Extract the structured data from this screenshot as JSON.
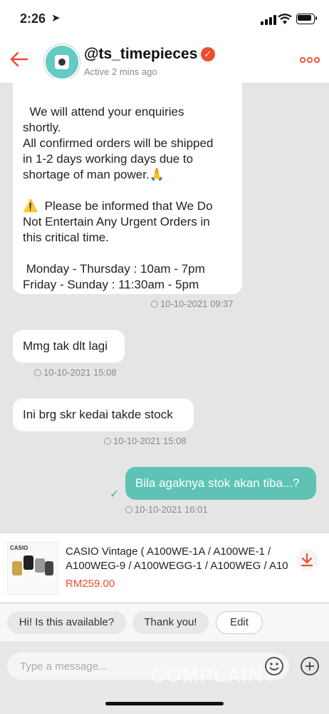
{
  "status_bar": {
    "time": "2:26",
    "location_glyph": "➤"
  },
  "header": {
    "shop_name": "@ts_timepieces",
    "status": "Active 2 mins ago",
    "verified_glyph": "✓",
    "more_glyph": "ooo"
  },
  "messages": [
    {
      "direction": "incoming",
      "lines": [
        "  We will attend your enquiries",
        "shortly.",
        "All confirmed orders will be shipped",
        "in 1-2 days working days due to",
        "shortage of man power.🙏",
        "",
        "⚠️  Please be informed that We Do",
        "Not Entertain Any Urgent Orders in",
        "this critical time.",
        "",
        " Monday - Thursday : 10am - 7pm",
        "Friday - Sunday : 11:30am - 5pm"
      ],
      "timestamp": "10-10-2021 09:37"
    },
    {
      "direction": "incoming",
      "text": "Mmg tak dlt lagi",
      "timestamp": "10-10-2021 15:08"
    },
    {
      "direction": "incoming",
      "text": "Ini brg skr kedai takde stock",
      "timestamp": "10-10-2021 15:08"
    },
    {
      "direction": "outgoing",
      "text": "Bila agaknya stok akan tiba...?",
      "timestamp": "10-10-2021 16:01",
      "read_glyph": "✓"
    }
  ],
  "product": {
    "title": "CASIO Vintage ( A100WE-1A / A100WE-1 / A100WEG-9 / A100WEGG-1 / A100WEG / A10",
    "price": "RM259.00",
    "image_brand": "CASIO"
  },
  "quick_replies": [
    "Hi! Is this available?",
    "Thank you!",
    "Edit"
  ],
  "input": {
    "placeholder": "Type a message..."
  },
  "watermark": "COMPLAINT",
  "colors": {
    "accent": "#ee4d2d",
    "outgoing_bubble": "#5ec3b5",
    "background": "#e5e5e5"
  },
  "icons": {
    "back": "arrow-left-icon",
    "verified": "verified-badge-icon",
    "more": "more-options-icon",
    "download": "download-icon",
    "emoji": "emoji-icon",
    "add": "plus-circle-icon",
    "clock": "clock-icon",
    "read": "check-icon"
  }
}
